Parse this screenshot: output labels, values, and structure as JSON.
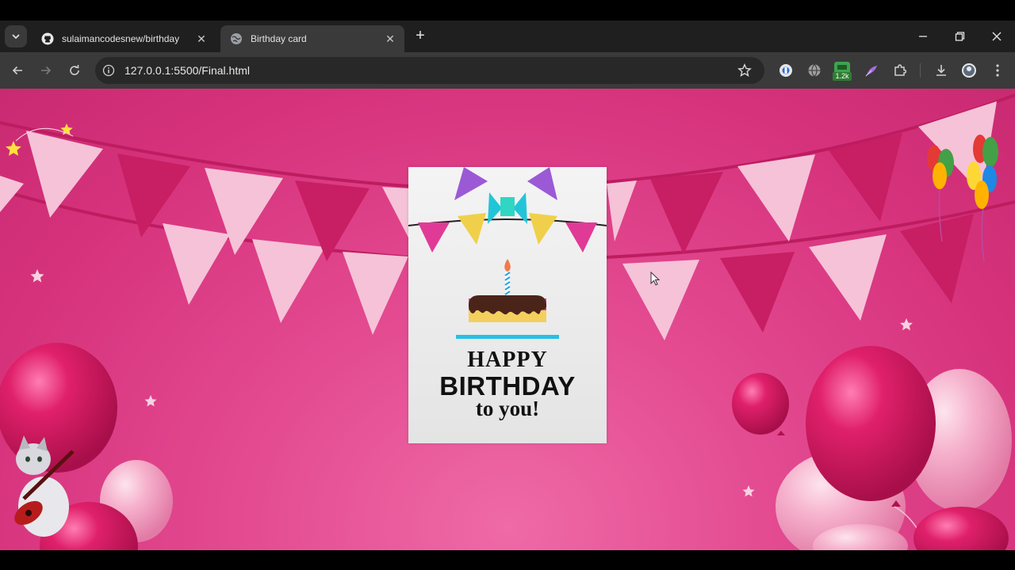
{
  "browser": {
    "tabs": [
      {
        "title": "sulaimancodesnew/birthday",
        "icon": "github-icon",
        "active": false
      },
      {
        "title": "Birthday card",
        "icon": "globe-icon",
        "active": true
      }
    ],
    "new_tab_label": "+",
    "url": "127.0.0.1:5500/Final.html",
    "extension_badge": "1.2k"
  },
  "card": {
    "line1": "HAPPY",
    "line2": "BIRTHDAY",
    "line3": "to you!"
  },
  "colors": {
    "page_pink": "#d6327c",
    "light_flag": "#f6c2d8",
    "dark_flag": "#c81e63",
    "balloon_magenta": "#d8195f",
    "balloon_pink": "#f4a0c0"
  }
}
